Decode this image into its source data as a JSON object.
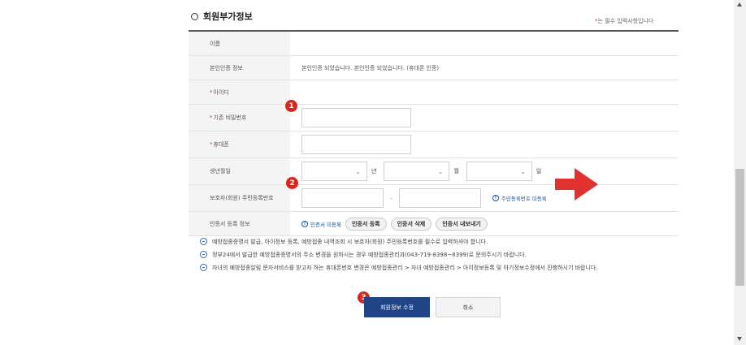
{
  "section": {
    "title": "회원부가정보",
    "required_note_star": "*",
    "required_note": "는 필수 입력사항입니다"
  },
  "rows": {
    "name": {
      "label": "이름"
    },
    "identity": {
      "label": "본인인증 정보",
      "value": "본인인증 되었습니다. 본인인증 되었습니다. (휴대폰 인증)"
    },
    "user_id": {
      "label": "아이디"
    },
    "current_password": {
      "label": "기존 비밀번호"
    },
    "mobile": {
      "label": "휴대폰"
    },
    "birthdate": {
      "label": "생년월일",
      "year_unit": "년",
      "month_unit": "월",
      "day_unit": "일"
    },
    "guardian_rrn": {
      "label": "보호자(회원) 주민등록번호",
      "dash": "-",
      "link": "주민등록번호 미등록"
    },
    "certificate": {
      "label": "인증서 등록 정보",
      "status": "인증서 미등록",
      "register_button": "인증서 등록",
      "delete_button": "인증서 삭제",
      "export_button": "인증서 내보내기"
    }
  },
  "star": "*",
  "badges": [
    "1",
    "2",
    "3"
  ],
  "notices": [
    "예방접종증명서 발급, 아이정보 등록, 예방접종 내역조회 시 보호자(회원) 주민등록번호를 필수로 입력하셔야 합니다.",
    "정부24에서 발급한 예방접종증명서의 주소 변경을 원하시는 경우 예방접종관리과(043-719-8398~8399)로 문의주시기 바랍니다.",
    "자녀의 예방접종알림 문자서비스를 받고자 하는 휴대폰번호 변경은 예방접종관리 > 자녀 예방접종관리 > 아이정보등록 및 아기정보수정에서 진행하시기 바랍니다."
  ],
  "buttons": {
    "submit": "회원정보 수정",
    "cancel": "취소"
  },
  "colors": {
    "primary": "#1f4487",
    "badge": "#d9261c",
    "arrow": "#e0312e",
    "link": "#1a4f9c"
  }
}
